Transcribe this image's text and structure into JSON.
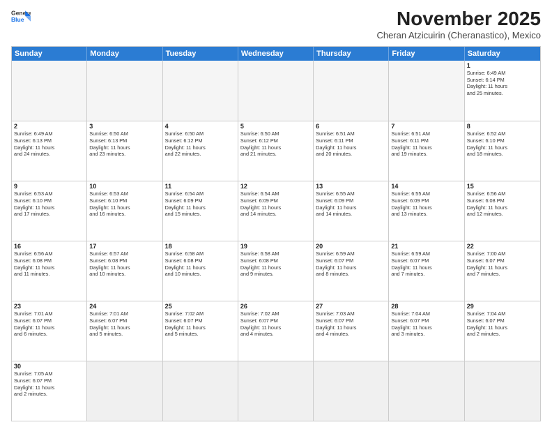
{
  "header": {
    "logo_line1": "General",
    "logo_line2": "Blue",
    "month_title": "November 2025",
    "subtitle": "Cheran Atzicuirin (Cheranastico), Mexico"
  },
  "days_of_week": [
    "Sunday",
    "Monday",
    "Tuesday",
    "Wednesday",
    "Thursday",
    "Friday",
    "Saturday"
  ],
  "rows": [
    [
      {
        "day": "",
        "info": ""
      },
      {
        "day": "",
        "info": ""
      },
      {
        "day": "",
        "info": ""
      },
      {
        "day": "",
        "info": ""
      },
      {
        "day": "",
        "info": ""
      },
      {
        "day": "",
        "info": ""
      },
      {
        "day": "1",
        "info": "Sunrise: 6:49 AM\nSunset: 6:14 PM\nDaylight: 11 hours\nand 25 minutes."
      }
    ],
    [
      {
        "day": "2",
        "info": "Sunrise: 6:49 AM\nSunset: 6:13 PM\nDaylight: 11 hours\nand 24 minutes."
      },
      {
        "day": "3",
        "info": "Sunrise: 6:50 AM\nSunset: 6:13 PM\nDaylight: 11 hours\nand 23 minutes."
      },
      {
        "day": "4",
        "info": "Sunrise: 6:50 AM\nSunset: 6:12 PM\nDaylight: 11 hours\nand 22 minutes."
      },
      {
        "day": "5",
        "info": "Sunrise: 6:50 AM\nSunset: 6:12 PM\nDaylight: 11 hours\nand 21 minutes."
      },
      {
        "day": "6",
        "info": "Sunrise: 6:51 AM\nSunset: 6:11 PM\nDaylight: 11 hours\nand 20 minutes."
      },
      {
        "day": "7",
        "info": "Sunrise: 6:51 AM\nSunset: 6:11 PM\nDaylight: 11 hours\nand 19 minutes."
      },
      {
        "day": "8",
        "info": "Sunrise: 6:52 AM\nSunset: 6:10 PM\nDaylight: 11 hours\nand 18 minutes."
      }
    ],
    [
      {
        "day": "9",
        "info": "Sunrise: 6:53 AM\nSunset: 6:10 PM\nDaylight: 11 hours\nand 17 minutes."
      },
      {
        "day": "10",
        "info": "Sunrise: 6:53 AM\nSunset: 6:10 PM\nDaylight: 11 hours\nand 16 minutes."
      },
      {
        "day": "11",
        "info": "Sunrise: 6:54 AM\nSunset: 6:09 PM\nDaylight: 11 hours\nand 15 minutes."
      },
      {
        "day": "12",
        "info": "Sunrise: 6:54 AM\nSunset: 6:09 PM\nDaylight: 11 hours\nand 14 minutes."
      },
      {
        "day": "13",
        "info": "Sunrise: 6:55 AM\nSunset: 6:09 PM\nDaylight: 11 hours\nand 14 minutes."
      },
      {
        "day": "14",
        "info": "Sunrise: 6:55 AM\nSunset: 6:09 PM\nDaylight: 11 hours\nand 13 minutes."
      },
      {
        "day": "15",
        "info": "Sunrise: 6:56 AM\nSunset: 6:08 PM\nDaylight: 11 hours\nand 12 minutes."
      }
    ],
    [
      {
        "day": "16",
        "info": "Sunrise: 6:56 AM\nSunset: 6:08 PM\nDaylight: 11 hours\nand 11 minutes."
      },
      {
        "day": "17",
        "info": "Sunrise: 6:57 AM\nSunset: 6:08 PM\nDaylight: 11 hours\nand 10 minutes."
      },
      {
        "day": "18",
        "info": "Sunrise: 6:58 AM\nSunset: 6:08 PM\nDaylight: 11 hours\nand 10 minutes."
      },
      {
        "day": "19",
        "info": "Sunrise: 6:58 AM\nSunset: 6:08 PM\nDaylight: 11 hours\nand 9 minutes."
      },
      {
        "day": "20",
        "info": "Sunrise: 6:59 AM\nSunset: 6:07 PM\nDaylight: 11 hours\nand 8 minutes."
      },
      {
        "day": "21",
        "info": "Sunrise: 6:59 AM\nSunset: 6:07 PM\nDaylight: 11 hours\nand 7 minutes."
      },
      {
        "day": "22",
        "info": "Sunrise: 7:00 AM\nSunset: 6:07 PM\nDaylight: 11 hours\nand 7 minutes."
      }
    ],
    [
      {
        "day": "23",
        "info": "Sunrise: 7:01 AM\nSunset: 6:07 PM\nDaylight: 11 hours\nand 6 minutes."
      },
      {
        "day": "24",
        "info": "Sunrise: 7:01 AM\nSunset: 6:07 PM\nDaylight: 11 hours\nand 5 minutes."
      },
      {
        "day": "25",
        "info": "Sunrise: 7:02 AM\nSunset: 6:07 PM\nDaylight: 11 hours\nand 5 minutes."
      },
      {
        "day": "26",
        "info": "Sunrise: 7:02 AM\nSunset: 6:07 PM\nDaylight: 11 hours\nand 4 minutes."
      },
      {
        "day": "27",
        "info": "Sunrise: 7:03 AM\nSunset: 6:07 PM\nDaylight: 11 hours\nand 4 minutes."
      },
      {
        "day": "28",
        "info": "Sunrise: 7:04 AM\nSunset: 6:07 PM\nDaylight: 11 hours\nand 3 minutes."
      },
      {
        "day": "29",
        "info": "Sunrise: 7:04 AM\nSunset: 6:07 PM\nDaylight: 11 hours\nand 2 minutes."
      }
    ],
    [
      {
        "day": "30",
        "info": "Sunrise: 7:05 AM\nSunset: 6:07 PM\nDaylight: 11 hours\nand 2 minutes."
      },
      {
        "day": "",
        "info": ""
      },
      {
        "day": "",
        "info": ""
      },
      {
        "day": "",
        "info": ""
      },
      {
        "day": "",
        "info": ""
      },
      {
        "day": "",
        "info": ""
      },
      {
        "day": "",
        "info": ""
      }
    ]
  ]
}
